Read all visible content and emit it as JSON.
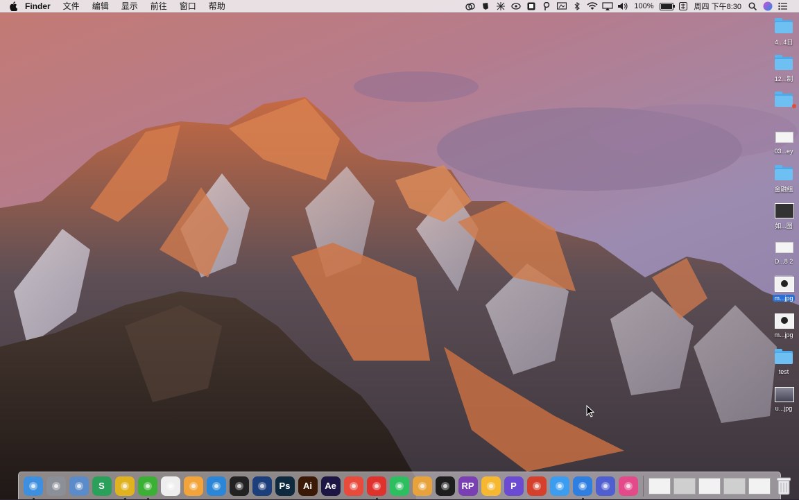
{
  "menubar": {
    "app_name": "Finder",
    "menus": [
      "文件",
      "编辑",
      "显示",
      "前往",
      "窗口",
      "帮助"
    ],
    "battery_percent": "100%",
    "battery_level": 1.0,
    "datetime": "周四 下午8:30",
    "status_icons": [
      "creative-cloud-icon",
      "evernote-helper-icon",
      "grid-icon",
      "wireless-app-icon",
      "screen-icon",
      "pin-icon",
      "display-icon",
      "bluetooth-icon",
      "wifi-icon",
      "airplay-icon",
      "volume-icon",
      "battery-icon",
      "input-method-icon",
      "spotlight-icon",
      "siri-icon",
      "notification-center-icon"
    ]
  },
  "desktop": {
    "icons": [
      {
        "label": "4...4日",
        "kind": "folder"
      },
      {
        "label": "12...制",
        "kind": "folder"
      },
      {
        "label": "",
        "kind": "folder-tagged"
      },
      {
        "label": "03...ey",
        "kind": "document"
      },
      {
        "label": "金融组",
        "kind": "folder"
      },
      {
        "label": "如...图",
        "kind": "image-dark"
      },
      {
        "label": "D...8 2",
        "kind": "document"
      },
      {
        "label": "m...jpg",
        "kind": "image-face",
        "selected": true
      },
      {
        "label": "m...jpg",
        "kind": "image-face"
      },
      {
        "label": "test",
        "kind": "folder"
      },
      {
        "label": "u...jpg",
        "kind": "image-photo"
      }
    ]
  },
  "dock": {
    "apps": [
      {
        "name": "finder-icon",
        "glyph": "",
        "color": "#3f8fe0",
        "running": true
      },
      {
        "name": "launchpad-icon",
        "glyph": "",
        "color": "#8a8f98",
        "running": false
      },
      {
        "name": "preview-icon",
        "glyph": "",
        "color": "#5b8bc9",
        "running": false
      },
      {
        "name": "sketchbook-icon",
        "glyph": "S",
        "color": "#2aa05a",
        "running": false
      },
      {
        "name": "chrome-icon",
        "glyph": "",
        "color": "#e0b21f",
        "running": true
      },
      {
        "name": "wechat-icon",
        "glyph": "",
        "color": "#3cb034",
        "running": true
      },
      {
        "name": "textedit-icon",
        "glyph": "",
        "color": "#eeeeee",
        "running": false
      },
      {
        "name": "pages-icon",
        "glyph": "",
        "color": "#f2a33a",
        "running": false
      },
      {
        "name": "keynote-icon",
        "glyph": "",
        "color": "#2b86d8",
        "running": false
      },
      {
        "name": "qq-icon",
        "glyph": "",
        "color": "#222222",
        "running": false
      },
      {
        "name": "cinema4d-icon",
        "glyph": "",
        "color": "#1c3e7a",
        "running": false
      },
      {
        "name": "photoshop-icon",
        "glyph": "Ps",
        "color": "#0d2a3f",
        "running": false
      },
      {
        "name": "illustrator-icon",
        "glyph": "Ai",
        "color": "#3a1a06",
        "running": false
      },
      {
        "name": "after-effects-icon",
        "glyph": "Ae",
        "color": "#1d1645",
        "running": false
      },
      {
        "name": "mindnode-icon",
        "glyph": "",
        "color": "#e84a3c",
        "running": false
      },
      {
        "name": "netease-music-icon",
        "glyph": "",
        "color": "#e0322d",
        "running": true
      },
      {
        "name": "evernote-icon",
        "glyph": "",
        "color": "#2dbe60",
        "running": false
      },
      {
        "name": "gif-brewery-icon",
        "glyph": "",
        "color": "#e8a23c",
        "running": false
      },
      {
        "name": "obs-icon",
        "glyph": "",
        "color": "#1e1e1e",
        "running": false
      },
      {
        "name": "axure-rp-icon",
        "glyph": "RP",
        "color": "#7a3fb3",
        "running": false
      },
      {
        "name": "sketch-icon",
        "glyph": "",
        "color": "#f6b830",
        "running": false
      },
      {
        "name": "pockity-icon",
        "glyph": "P",
        "color": "#6b4bd1",
        "running": false
      },
      {
        "name": "clipboard-icon",
        "glyph": "",
        "color": "#d4402c",
        "running": false
      },
      {
        "name": "app-store-icon",
        "glyph": "",
        "color": "#3b9cf0",
        "running": false
      },
      {
        "name": "safari-icon",
        "glyph": "",
        "color": "#2f7fe0",
        "running": true
      },
      {
        "name": "imovie-icon",
        "glyph": "",
        "color": "#4f5fcf",
        "running": false
      },
      {
        "name": "itunes-icon",
        "glyph": "",
        "color": "#e24a8a",
        "running": false
      }
    ],
    "windows": [
      "minimized-window",
      "minimized-window",
      "minimized-window",
      "minimized-window",
      "minimized-window"
    ],
    "trash": "trash-icon"
  }
}
